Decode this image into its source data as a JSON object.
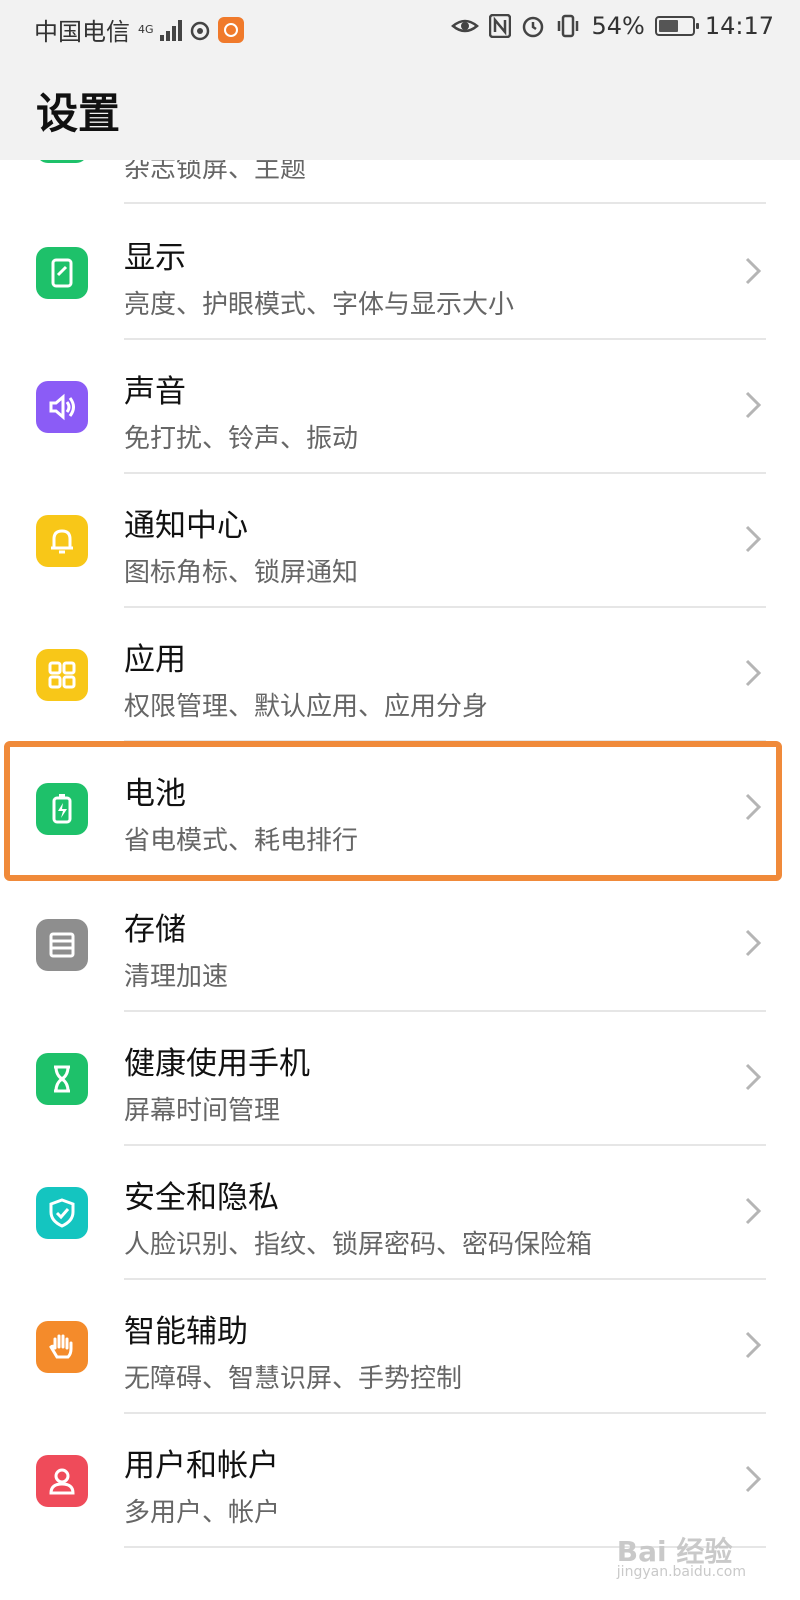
{
  "status_bar": {
    "carrier": "中国电信",
    "network": "4G",
    "battery_percent": "54%",
    "time": "14:17"
  },
  "header": {
    "title": "设置"
  },
  "settings": [
    {
      "label": "",
      "sub": "杂志锁屏、主题",
      "icon": "theme-icon",
      "color": "#1ec16a"
    },
    {
      "label": "显示",
      "sub": "亮度、护眼模式、字体与显示大小",
      "icon": "display-icon",
      "color": "#1ec16a"
    },
    {
      "label": "声音",
      "sub": "免打扰、铃声、振动",
      "icon": "speaker-icon",
      "color": "#8b5cf6"
    },
    {
      "label": "通知中心",
      "sub": "图标角标、锁屏通知",
      "icon": "bell-icon",
      "color": "#f8c718"
    },
    {
      "label": "应用",
      "sub": "权限管理、默认应用、应用分身",
      "icon": "apps-grid-icon",
      "color": "#f8c718"
    },
    {
      "label": "电池",
      "sub": "省电模式、耗电排行",
      "icon": "battery-icon",
      "color": "#1ec16a"
    },
    {
      "label": "存储",
      "sub": "清理加速",
      "icon": "storage-icon",
      "color": "#8e8e8e"
    },
    {
      "label": "健康使用手机",
      "sub": "屏幕时间管理",
      "icon": "hourglass-icon",
      "color": "#1ec16a"
    },
    {
      "label": "安全和隐私",
      "sub": "人脸识别、指纹、锁屏密码、密码保险箱",
      "icon": "shield-icon",
      "color": "#14c5c0"
    },
    {
      "label": "智能辅助",
      "sub": "无障碍、智慧识屏、手势控制",
      "icon": "hand-icon",
      "color": "#f48b2b"
    },
    {
      "label": "用户和帐户",
      "sub": "多用户、帐户",
      "icon": "user-icon",
      "color": "#ef4b5a"
    }
  ],
  "highlighted_item": "电池",
  "watermark": {
    "text": "Bai 经验",
    "sub": "jingyan.baidu.com"
  }
}
